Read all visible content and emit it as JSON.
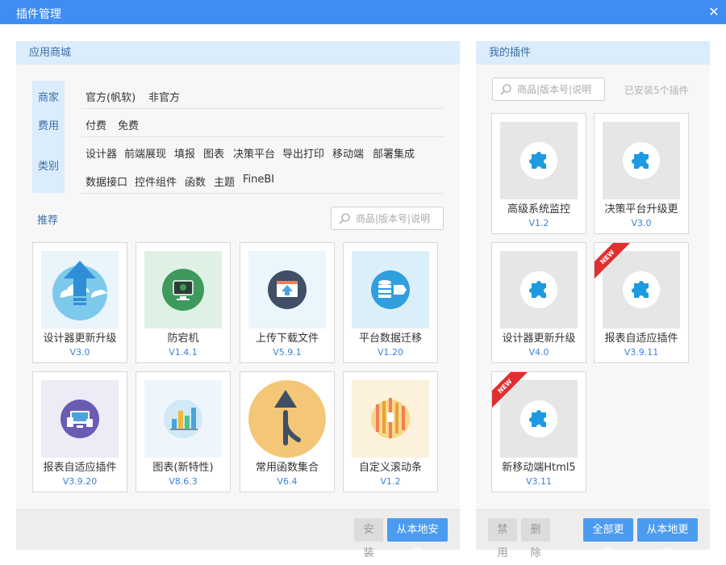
{
  "window": {
    "title": "插件管理",
    "close_icon": "close-icon"
  },
  "store": {
    "header": "应用商城",
    "filter_tabs": [
      "商家",
      "费用",
      "类别"
    ],
    "vendor_options": [
      "官方(帆软)",
      "非官方"
    ],
    "fee_options": [
      "付费",
      "免费"
    ],
    "category_options_row1": [
      "设计器",
      "前端展现",
      "填报",
      "图表",
      "决策平台",
      "导出打印",
      "移动端",
      "部署集成"
    ],
    "category_options_row2": [
      "数据接口",
      "控件组件",
      "函数",
      "主题",
      "FineBI"
    ],
    "recommend_label": "推荐",
    "search_placeholder": "商品|版本号|说明",
    "plugins": [
      {
        "name": "设计器更新升级",
        "version": "V3.0",
        "icon": "upload-arrow-icon",
        "color": "#5bbde8"
      },
      {
        "name": "防宕机",
        "version": "V1.4.1",
        "icon": "monitor-icon",
        "color": "#3d9a5c"
      },
      {
        "name": "上传下载文件",
        "version": "V5.9.1",
        "icon": "upload-file-icon",
        "color": "#3e4f66"
      },
      {
        "name": "平台数据迁移",
        "version": "V1.20",
        "icon": "database-icon",
        "color": "#2f9fe0"
      },
      {
        "name": "报表自适应插件",
        "version": "V3.9.20",
        "icon": "devices-icon",
        "color": "#6b5bb3"
      },
      {
        "name": "图表(新特性)",
        "version": "V8.6.3",
        "icon": "bar-chart-icon",
        "color": "#dfeef8"
      },
      {
        "name": "常用函数集合",
        "version": "V6.4",
        "icon": "merge-arrow-icon",
        "color": "#f3c777"
      },
      {
        "name": "自定义滚动条",
        "version": "V1.2",
        "icon": "scrollbar-icon",
        "color": "#f6d889"
      }
    ],
    "buttons": {
      "install": "安装",
      "install_local": "从本地安装"
    }
  },
  "mine": {
    "header": "我的插件",
    "search_placeholder": "商品|版本号|说明",
    "installed_count": "已安装5个插件",
    "plugins": [
      {
        "name": "高级系统监控",
        "version": "V1.2",
        "icon": "puzzle-icon",
        "is_new": false
      },
      {
        "name": "决策平台升级更",
        "version": "V3.0",
        "icon": "puzzle-icon",
        "is_new": false
      },
      {
        "name": "设计器更新升级",
        "version": "V4.0",
        "icon": "puzzle-icon",
        "is_new": false
      },
      {
        "name": "报表自适应插件",
        "version": "V3.9.11",
        "icon": "puzzle-icon",
        "is_new": true
      },
      {
        "name": "新移动端Html5",
        "version": "V3.11",
        "icon": "puzzle-icon",
        "is_new": true
      }
    ],
    "new_badge": "NEW",
    "buttons": {
      "disable": "禁用",
      "delete": "删除",
      "update_all": "全部更新",
      "update_local": "从本地更新"
    }
  },
  "colors": {
    "accent": "#3f8df3",
    "panel_header": "#dbecfc",
    "link_blue": "#3b82d6",
    "ribbon_red": "#e02f2f"
  }
}
